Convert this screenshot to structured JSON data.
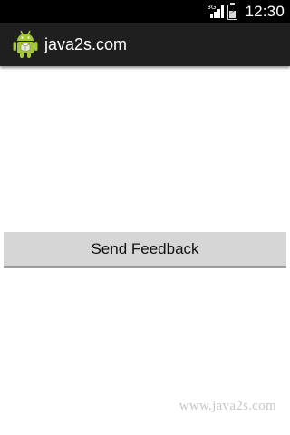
{
  "status_bar": {
    "network_type": "3G",
    "time": "12:30",
    "icons": [
      "signal-icon",
      "battery-charging-icon"
    ]
  },
  "action_bar": {
    "app_icon": "android-icon",
    "title": "java2s.com",
    "background_color": "#1f1f1f",
    "icon_color": "#a4c639"
  },
  "main": {
    "send_feedback_button_label": "Send Feedback"
  },
  "watermark": {
    "text": "www.java2s.com"
  }
}
